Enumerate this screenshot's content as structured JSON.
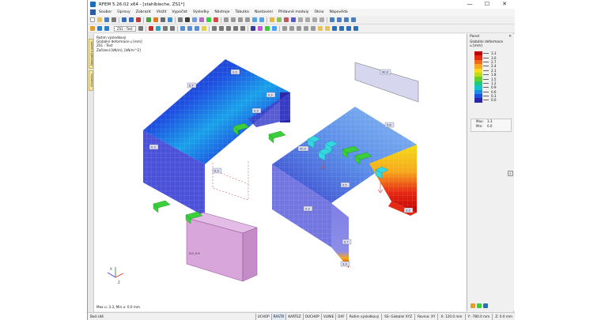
{
  "window": {
    "title": "RFEM 5.26.02 x64 - [stahlbleche, ZS1*]",
    "minimize": "—",
    "maximize": "☐",
    "close": "✕"
  },
  "menu": [
    "Soubor",
    "Úpravy",
    "Zobrazit",
    "Vložit",
    "Vypočíst",
    "Výsledky",
    "Nástroje",
    "Tabulka",
    "Nastavení",
    "Přídavné moduly",
    "Okno",
    "Nápověda"
  ],
  "toolbar": {
    "loadcase_select": "ZS1 - Test"
  },
  "left_tabs": [
    "Navigační panel",
    "Výsledky"
  ],
  "viewport": {
    "info_lines": [
      "Režim výsledkový",
      "Globální deformace u [mm]",
      "ZS1 : Test",
      "Zařízení [kN/m], [kN/m^2]"
    ],
    "maxmin_text": "Max u: 3.3, Min u: 0.0 mm",
    "labels": {
      "l1": "0.3",
      "l2": "0.7",
      "l3": "0.3",
      "l4": "0.3",
      "l5": "0.3",
      "l6": "90.0",
      "l7": "50.0",
      "l8": "0.8",
      "l9": "0.5",
      "l10": "3.3",
      "l11": "3.3",
      "l12": "0.3",
      "l13": "0.3",
      "l14": "0.7",
      "l15": "0.0, 0.0"
    }
  },
  "panel": {
    "title": "Panel",
    "close": "✕",
    "subtitle1": "Globální deformace",
    "subtitle2": "u [mm]",
    "legend": [
      {
        "value": "3.3",
        "color": "#c00000"
      },
      {
        "value": "3.0",
        "color": "#e52a14"
      },
      {
        "value": "2.7",
        "color": "#f06a1a"
      },
      {
        "value": "2.4",
        "color": "#f6a81c"
      },
      {
        "value": "2.1",
        "color": "#f3dc1a"
      },
      {
        "value": "1.8",
        "color": "#bcdc19"
      },
      {
        "value": "1.5",
        "color": "#63cf2a"
      },
      {
        "value": "1.2",
        "color": "#1ecb7a"
      },
      {
        "value": "0.9",
        "color": "#16c2c8"
      },
      {
        "value": "0.6",
        "color": "#1a8fe6"
      },
      {
        "value": "0.3",
        "color": "#1e4fe0"
      },
      {
        "value": "0.0",
        "color": "#2a27a8"
      }
    ],
    "max_label": "Max:",
    "max_value": "3.3",
    "min_label": "Min:",
    "min_value": "0.0",
    "zoom_icon": "⌕"
  },
  "status": {
    "left": "Bod sítě",
    "buttons": [
      "UCHOP",
      "RASTR",
      "KARTEZ",
      "OUCHOP",
      "VLINIE",
      "DXF"
    ],
    "mode": "Režim výsledkový",
    "coord_system": "SS: Globální XYZ",
    "plane": "Rovina: XY",
    "x": "X: 120.0 mm",
    "y": "Y: -780.0 mm",
    "z": "Z: 0.0 mm"
  },
  "colors": {
    "accent": "#1c6fb5",
    "member_blue": "#2a27a8",
    "support_green": "#3ccf3c",
    "solid_pink": "#d9a6dc"
  }
}
